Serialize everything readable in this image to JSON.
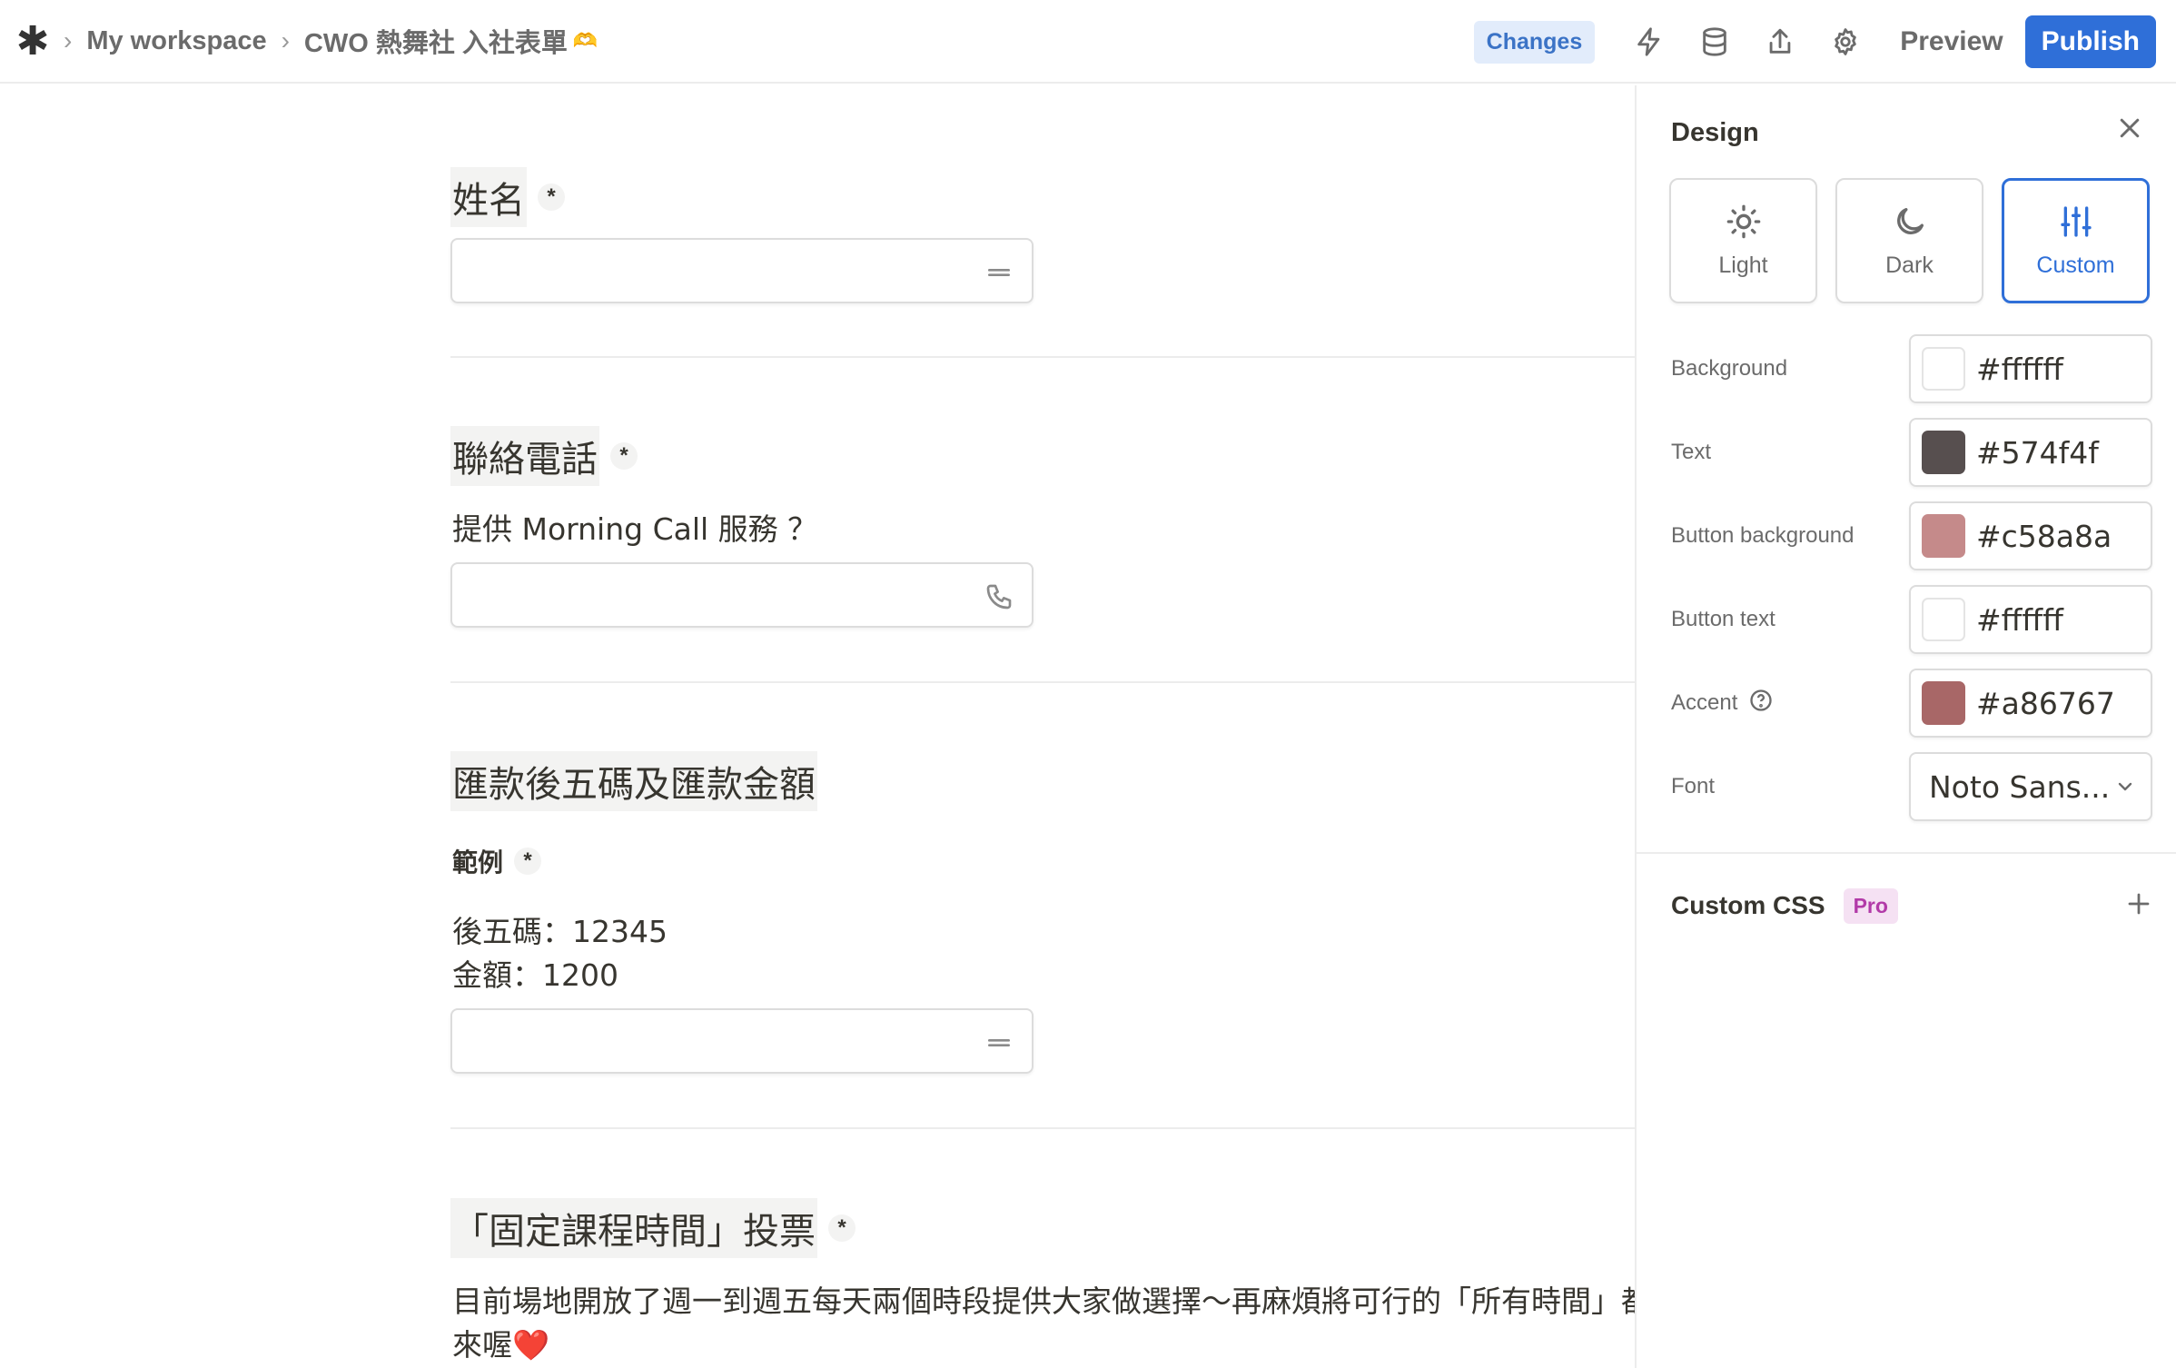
{
  "topbar": {
    "logo": "✱",
    "breadcrumb": [
      "My workspace",
      "CWO 熱舞社 入社表單"
    ],
    "title_emoji": "🫶",
    "changes_label": "Changes",
    "icons": [
      "lightning-icon",
      "database-icon",
      "share-icon",
      "gear-icon"
    ],
    "preview_label": "Preview",
    "publish_label": "Publish"
  },
  "form": {
    "questions": [
      {
        "title": "姓名",
        "required_mark": "*",
        "input_icon": "short-text-icon"
      },
      {
        "title": "聯絡電話",
        "required_mark": "*",
        "description": "提供 Morning Call 服務 ？",
        "input_icon": "phone-icon"
      },
      {
        "title": "匯款後五碼及匯款金額",
        "sub_label": "範例",
        "required_mark": "*",
        "description_lines": [
          "後五碼：12345",
          "金額：1200"
        ],
        "input_icon": "short-text-icon"
      },
      {
        "title": "「固定課程時間」投票",
        "required_mark": "*",
        "description_lines": [
          "目前場地開放了週一到週五每天兩個時段提供大家做選擇～再麻煩將可行的「所有時間」都選",
          "來喔"
        ],
        "description_emoji": "❤️"
      }
    ]
  },
  "design_panel": {
    "title": "Design",
    "themes": [
      {
        "label": "Light",
        "icon": "sun-icon",
        "active": false
      },
      {
        "label": "Dark",
        "icon": "moon-icon",
        "active": false
      },
      {
        "label": "Custom",
        "icon": "sliders-icon",
        "active": true
      }
    ],
    "settings": [
      {
        "label": "Background",
        "value": "#ffffff"
      },
      {
        "label": "Text",
        "value": "#574f4f"
      },
      {
        "label": "Button background",
        "value": "#c58a8a"
      },
      {
        "label": "Button text",
        "value": "#ffffff"
      },
      {
        "label": "Accent",
        "value": "#a86767"
      }
    ],
    "font": {
      "label": "Font",
      "value": "Noto Sans..."
    },
    "custom_css": {
      "title": "Custom CSS",
      "badge": "Pro"
    }
  },
  "colors": {
    "publish": "#2f6fd8",
    "changes_bg": "#e2ecfb",
    "pro_bg": "#f5e1f3",
    "pro_text": "#b23aa8"
  }
}
